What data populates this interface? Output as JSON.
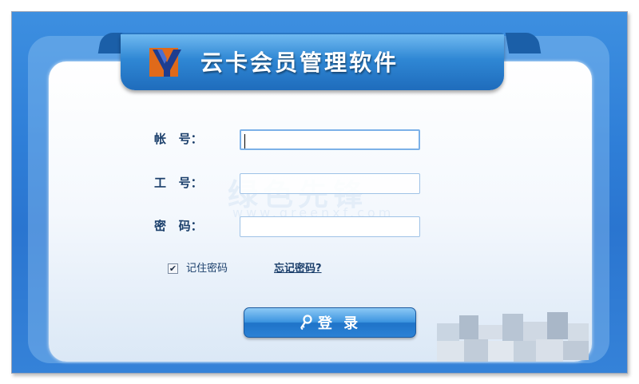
{
  "header": {
    "title": "云卡会员管理软件",
    "logo_icon": "yk-logo-icon"
  },
  "form": {
    "account_label": "帐   号：",
    "account_value": "",
    "employee_label": "工   号：",
    "employee_value": "",
    "password_label": "密   码：",
    "password_value": "",
    "remember_label": "记住密码",
    "remember_checked": true,
    "forgot_label": "忘记密码?"
  },
  "login": {
    "label": "登 录",
    "icon": "key-icon"
  },
  "watermark": {
    "line1": "绿色先锋",
    "line2": "www.greenxf.com"
  },
  "colors": {
    "frame_blue": "#2f7fd8",
    "banner_blue": "#2f87d4",
    "label_text": "#1b3f6b",
    "logo_orange": "#e06a1a",
    "logo_navy": "#1e3d8f"
  }
}
